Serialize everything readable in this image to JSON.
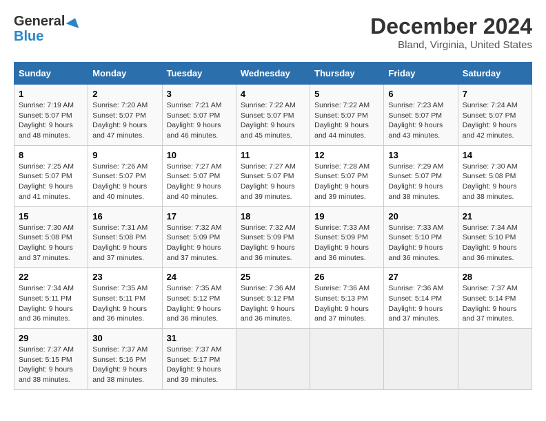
{
  "header": {
    "logo_line1": "General",
    "logo_line2": "Blue",
    "title": "December 2024",
    "subtitle": "Bland, Virginia, United States"
  },
  "columns": [
    "Sunday",
    "Monday",
    "Tuesday",
    "Wednesday",
    "Thursday",
    "Friday",
    "Saturday"
  ],
  "weeks": [
    [
      {
        "day": "1",
        "sunrise": "Sunrise: 7:19 AM",
        "sunset": "Sunset: 5:07 PM",
        "daylight": "Daylight: 9 hours and 48 minutes."
      },
      {
        "day": "2",
        "sunrise": "Sunrise: 7:20 AM",
        "sunset": "Sunset: 5:07 PM",
        "daylight": "Daylight: 9 hours and 47 minutes."
      },
      {
        "day": "3",
        "sunrise": "Sunrise: 7:21 AM",
        "sunset": "Sunset: 5:07 PM",
        "daylight": "Daylight: 9 hours and 46 minutes."
      },
      {
        "day": "4",
        "sunrise": "Sunrise: 7:22 AM",
        "sunset": "Sunset: 5:07 PM",
        "daylight": "Daylight: 9 hours and 45 minutes."
      },
      {
        "day": "5",
        "sunrise": "Sunrise: 7:22 AM",
        "sunset": "Sunset: 5:07 PM",
        "daylight": "Daylight: 9 hours and 44 minutes."
      },
      {
        "day": "6",
        "sunrise": "Sunrise: 7:23 AM",
        "sunset": "Sunset: 5:07 PM",
        "daylight": "Daylight: 9 hours and 43 minutes."
      },
      {
        "day": "7",
        "sunrise": "Sunrise: 7:24 AM",
        "sunset": "Sunset: 5:07 PM",
        "daylight": "Daylight: 9 hours and 42 minutes."
      }
    ],
    [
      {
        "day": "8",
        "sunrise": "Sunrise: 7:25 AM",
        "sunset": "Sunset: 5:07 PM",
        "daylight": "Daylight: 9 hours and 41 minutes."
      },
      {
        "day": "9",
        "sunrise": "Sunrise: 7:26 AM",
        "sunset": "Sunset: 5:07 PM",
        "daylight": "Daylight: 9 hours and 40 minutes."
      },
      {
        "day": "10",
        "sunrise": "Sunrise: 7:27 AM",
        "sunset": "Sunset: 5:07 PM",
        "daylight": "Daylight: 9 hours and 40 minutes."
      },
      {
        "day": "11",
        "sunrise": "Sunrise: 7:27 AM",
        "sunset": "Sunset: 5:07 PM",
        "daylight": "Daylight: 9 hours and 39 minutes."
      },
      {
        "day": "12",
        "sunrise": "Sunrise: 7:28 AM",
        "sunset": "Sunset: 5:07 PM",
        "daylight": "Daylight: 9 hours and 39 minutes."
      },
      {
        "day": "13",
        "sunrise": "Sunrise: 7:29 AM",
        "sunset": "Sunset: 5:07 PM",
        "daylight": "Daylight: 9 hours and 38 minutes."
      },
      {
        "day": "14",
        "sunrise": "Sunrise: 7:30 AM",
        "sunset": "Sunset: 5:08 PM",
        "daylight": "Daylight: 9 hours and 38 minutes."
      }
    ],
    [
      {
        "day": "15",
        "sunrise": "Sunrise: 7:30 AM",
        "sunset": "Sunset: 5:08 PM",
        "daylight": "Daylight: 9 hours and 37 minutes."
      },
      {
        "day": "16",
        "sunrise": "Sunrise: 7:31 AM",
        "sunset": "Sunset: 5:08 PM",
        "daylight": "Daylight: 9 hours and 37 minutes."
      },
      {
        "day": "17",
        "sunrise": "Sunrise: 7:32 AM",
        "sunset": "Sunset: 5:09 PM",
        "daylight": "Daylight: 9 hours and 37 minutes."
      },
      {
        "day": "18",
        "sunrise": "Sunrise: 7:32 AM",
        "sunset": "Sunset: 5:09 PM",
        "daylight": "Daylight: 9 hours and 36 minutes."
      },
      {
        "day": "19",
        "sunrise": "Sunrise: 7:33 AM",
        "sunset": "Sunset: 5:09 PM",
        "daylight": "Daylight: 9 hours and 36 minutes."
      },
      {
        "day": "20",
        "sunrise": "Sunrise: 7:33 AM",
        "sunset": "Sunset: 5:10 PM",
        "daylight": "Daylight: 9 hours and 36 minutes."
      },
      {
        "day": "21",
        "sunrise": "Sunrise: 7:34 AM",
        "sunset": "Sunset: 5:10 PM",
        "daylight": "Daylight: 9 hours and 36 minutes."
      }
    ],
    [
      {
        "day": "22",
        "sunrise": "Sunrise: 7:34 AM",
        "sunset": "Sunset: 5:11 PM",
        "daylight": "Daylight: 9 hours and 36 minutes."
      },
      {
        "day": "23",
        "sunrise": "Sunrise: 7:35 AM",
        "sunset": "Sunset: 5:11 PM",
        "daylight": "Daylight: 9 hours and 36 minutes."
      },
      {
        "day": "24",
        "sunrise": "Sunrise: 7:35 AM",
        "sunset": "Sunset: 5:12 PM",
        "daylight": "Daylight: 9 hours and 36 minutes."
      },
      {
        "day": "25",
        "sunrise": "Sunrise: 7:36 AM",
        "sunset": "Sunset: 5:12 PM",
        "daylight": "Daylight: 9 hours and 36 minutes."
      },
      {
        "day": "26",
        "sunrise": "Sunrise: 7:36 AM",
        "sunset": "Sunset: 5:13 PM",
        "daylight": "Daylight: 9 hours and 37 minutes."
      },
      {
        "day": "27",
        "sunrise": "Sunrise: 7:36 AM",
        "sunset": "Sunset: 5:14 PM",
        "daylight": "Daylight: 9 hours and 37 minutes."
      },
      {
        "day": "28",
        "sunrise": "Sunrise: 7:37 AM",
        "sunset": "Sunset: 5:14 PM",
        "daylight": "Daylight: 9 hours and 37 minutes."
      }
    ],
    [
      {
        "day": "29",
        "sunrise": "Sunrise: 7:37 AM",
        "sunset": "Sunset: 5:15 PM",
        "daylight": "Daylight: 9 hours and 38 minutes."
      },
      {
        "day": "30",
        "sunrise": "Sunrise: 7:37 AM",
        "sunset": "Sunset: 5:16 PM",
        "daylight": "Daylight: 9 hours and 38 minutes."
      },
      {
        "day": "31",
        "sunrise": "Sunrise: 7:37 AM",
        "sunset": "Sunset: 5:17 PM",
        "daylight": "Daylight: 9 hours and 39 minutes."
      },
      null,
      null,
      null,
      null
    ]
  ]
}
